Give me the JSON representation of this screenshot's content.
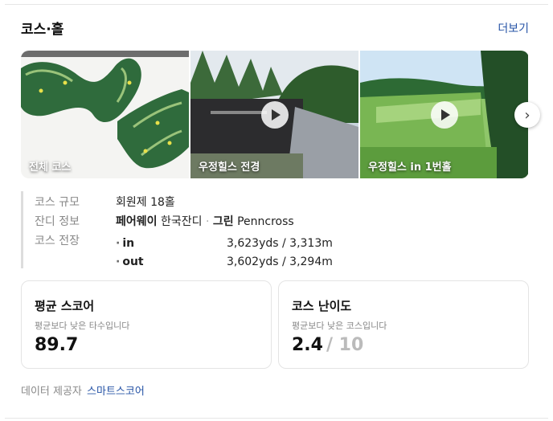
{
  "header": {
    "title": "코스·홀",
    "more_label": "더보기"
  },
  "gallery": {
    "items": [
      {
        "caption": "전체 코스",
        "kind": "map"
      },
      {
        "caption": "우정힐스 전경",
        "kind": "video"
      },
      {
        "caption": "우정힐스 in 1번홀",
        "kind": "video"
      }
    ],
    "next_icon": "chevron-right-icon"
  },
  "info": {
    "size_label": "코스 규모",
    "size_value": "회원제 18홀",
    "grass_label": "잔디 정보",
    "grass_fairway": "페어웨이",
    "grass_fairway_value": "한국잔디",
    "grass_dot": "·",
    "grass_green": "그린",
    "grass_green_value": "Penncross",
    "length_label": "코스 전장",
    "in_label": "in",
    "in_value": "3,623yds / 3,313m",
    "out_label": "out",
    "out_value": "3,602yds / 3,294m"
  },
  "score_box": {
    "title": "평균 스코어",
    "desc": "평균보다 낮은 타수입니다",
    "value": "89.7"
  },
  "difficulty_box": {
    "title": "코스 난이도",
    "desc": "평균보다 낮은 코스입니다",
    "value": "2.4",
    "max": "/ 10"
  },
  "footer": {
    "label": "데이터 제공자",
    "provider": "스마트스코어"
  }
}
